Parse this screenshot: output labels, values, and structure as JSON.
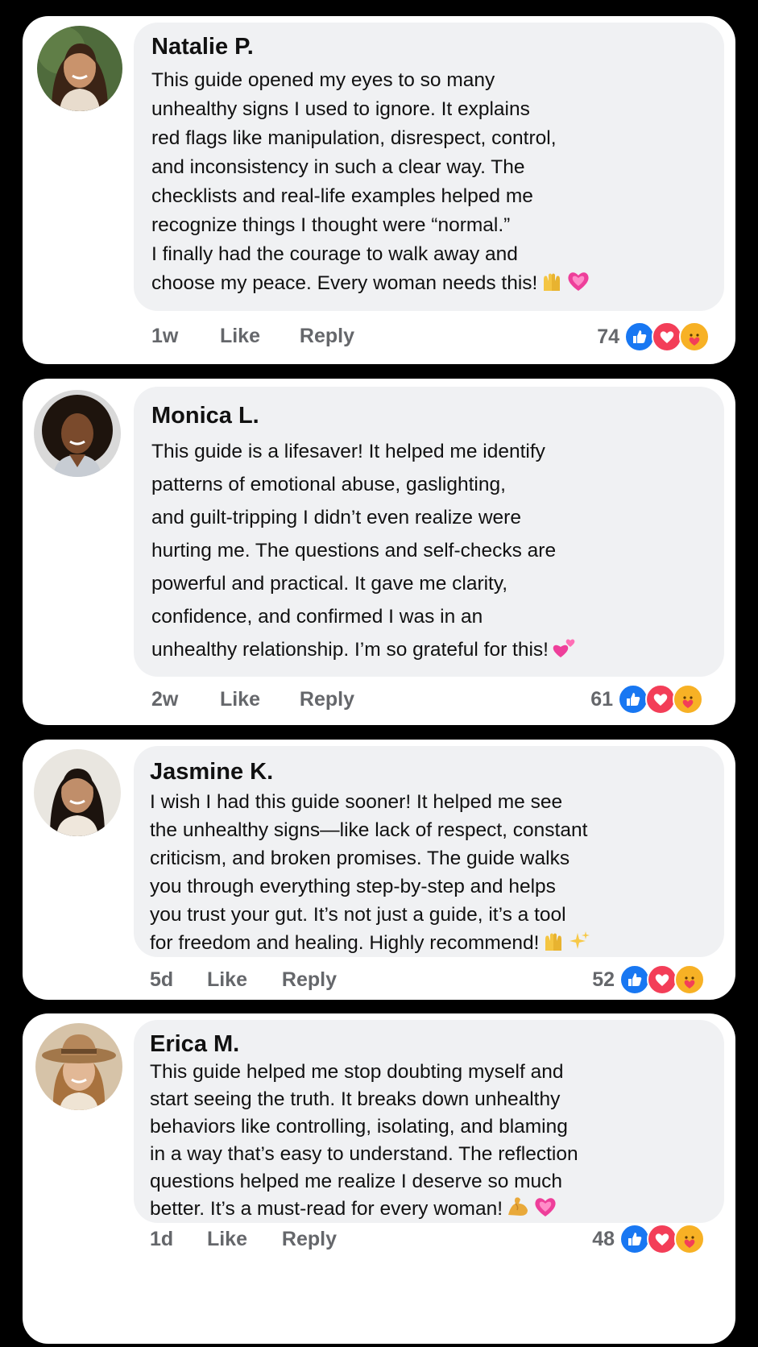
{
  "comments": [
    {
      "name": "Natalie P.",
      "lines": [
        "This guide opened my eyes to so many",
        "unhealthy signs I used to ignore. It explains",
        "red flags like manipulation, disrespect, control,",
        "and inconsistency in such a clear way. The",
        "checklists and real-life examples helped me",
        "recognize things I thought were “normal.”",
        "I finally had the courage to walk away and",
        "choose my peace. Every woman needs this!"
      ],
      "emojis": [
        "raising-hands",
        "growing-heart"
      ],
      "time": "1w",
      "like_label": "Like",
      "reply_label": "Reply",
      "reaction_count": "74",
      "reactions": [
        "like",
        "love",
        "care"
      ]
    },
    {
      "name": "Monica L.",
      "lines": [
        "This guide is a lifesaver! It helped me identify",
        "patterns of emotional abuse, gaslighting,",
        "and guilt-tripping I didn’t even realize were",
        "hurting me. The questions and self-checks are",
        "powerful and practical. It gave me clarity,",
        "confidence, and confirmed I was in an",
        "unhealthy relationship. I’m so grateful for this!"
      ],
      "emojis": [
        "two-hearts"
      ],
      "time": "2w",
      "like_label": "Like",
      "reply_label": "Reply",
      "reaction_count": "61",
      "reactions": [
        "like",
        "love",
        "care"
      ]
    },
    {
      "name": "Jasmine K.",
      "lines": [
        "I wish I had this guide sooner! It helped me see",
        "the unhealthy signs—like lack of respect, constant",
        "criticism, and broken promises. The guide walks",
        "you through everything step-by-step and helps",
        "you trust your gut. It’s not just a guide, it’s a tool",
        "for freedom and healing. Highly recommend!"
      ],
      "emojis": [
        "raising-hands",
        "sparkles"
      ],
      "time": "5d",
      "like_label": "Like",
      "reply_label": "Reply",
      "reaction_count": "52",
      "reactions": [
        "like",
        "love",
        "care"
      ]
    },
    {
      "name": "Erica M.",
      "lines": [
        "This guide helped me stop doubting myself and",
        "start seeing the truth. It breaks down unhealthy",
        "behaviors like controlling, isolating, and blaming",
        "in a way that’s easy to understand. The reflection",
        "questions helped me realize I deserve so much",
        "better. It’s a must-read for every woman!"
      ],
      "emojis": [
        "flexed-biceps",
        "growing-heart"
      ],
      "time": "1d",
      "like_label": "Like",
      "reply_label": "Reply",
      "reaction_count": "48",
      "reactions": [
        "like",
        "love",
        "care"
      ]
    }
  ],
  "colors": {
    "like": "#1877f2",
    "love": "#f33e58",
    "care": "#f7b125",
    "bubble": "#f0f1f3",
    "meta_text": "#65676b"
  }
}
